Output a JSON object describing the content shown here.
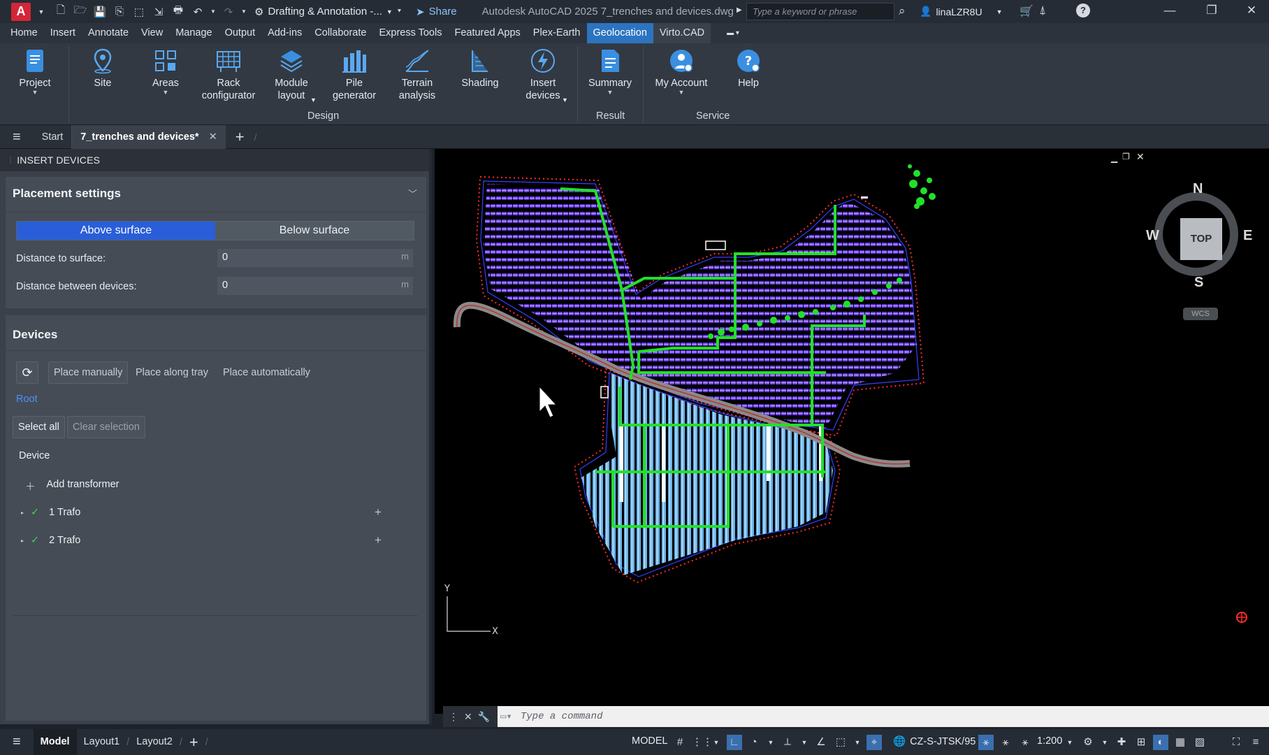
{
  "titlebar": {
    "workspace": "Drafting & Annotation -...",
    "share": "Share",
    "app_title": "Autodesk AutoCAD 2025    7_trenches and devices.dwg",
    "search_placeholder": "Type a keyword or phrase",
    "user": "linaLZR8U"
  },
  "menubar": [
    "Home",
    "Insert",
    "Annotate",
    "View",
    "Manage",
    "Output",
    "Add-ins",
    "Collaborate",
    "Express Tools",
    "Featured Apps",
    "Plex-Earth",
    "Geolocation",
    "Virto.CAD"
  ],
  "ribbon": {
    "buttons": [
      {
        "l1": "Project",
        "l2": ""
      },
      {
        "l1": "Site",
        "l2": ""
      },
      {
        "l1": "Areas",
        "l2": ""
      },
      {
        "l1": "Rack",
        "l2": "configurator"
      },
      {
        "l1": "Module",
        "l2": "layout"
      },
      {
        "l1": "Pile",
        "l2": "generator"
      },
      {
        "l1": "Terrain",
        "l2": "analysis"
      },
      {
        "l1": "Shading",
        "l2": ""
      },
      {
        "l1": "Insert",
        "l2": "devices"
      },
      {
        "l1": "Summary",
        "l2": ""
      },
      {
        "l1": "My Account",
        "l2": ""
      },
      {
        "l1": "Help",
        "l2": ""
      }
    ],
    "panels": {
      "design": "Design",
      "result": "Result",
      "service": "Service"
    }
  },
  "tabs": {
    "start": "Start",
    "doc": "7_trenches and devices*"
  },
  "palette": {
    "title": "INSERT DEVICES",
    "placement": {
      "title": "Placement settings",
      "above": "Above surface",
      "below": "Below surface",
      "dist_surface_label": "Distance to surface:",
      "dist_surface_value": "0",
      "dist_devices_label": "Distance between devices:",
      "dist_devices_value": "0",
      "unit": "m"
    },
    "devices": {
      "title": "Devices",
      "place_manually": "Place manually",
      "place_along_tray": "Place along tray",
      "place_automatically": "Place automatically",
      "root": "Root",
      "select_all": "Select all",
      "clear_selection": "Clear selection",
      "column": "Device",
      "add_transformer": "Add transformer",
      "items": [
        "1 Trafo",
        "2 Trafo"
      ]
    }
  },
  "viewcube": {
    "n": "N",
    "s": "S",
    "e": "E",
    "w": "W",
    "top": "TOP",
    "wcs": "WCS"
  },
  "command": {
    "placeholder": "Type a command"
  },
  "statusbar": {
    "model_tab": "Model",
    "layout1": "Layout1",
    "layout2": "Layout2",
    "model": "MODEL",
    "coord_system": "CZ-S-JTSK/95",
    "scale": "1:200"
  },
  "colors": {
    "accent": "#2a5ed8",
    "ribbon_active": "#2c74c0",
    "trench": "#22e02a",
    "boundary": "#ff2a2a",
    "modules_north": "#6a3cf0",
    "modules_south": "#6bb3e8"
  }
}
